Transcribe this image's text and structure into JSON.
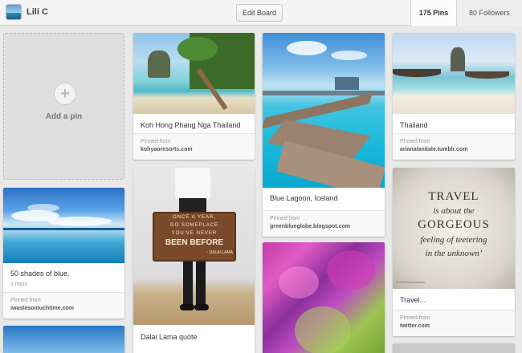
{
  "header": {
    "username": "Lili C",
    "edit_board_label": "Edit Board",
    "pins_count": "175 Pins",
    "followers_count": "80 Followers"
  },
  "add_pin": {
    "label": "Add a pin",
    "icon": "plus-icon"
  },
  "pinned_from_label": "Pinned from",
  "pins": {
    "shades_of_blue": {
      "title": "50 shades of blue.",
      "repins": "1 repin",
      "source": "iwastesomuchtime.com"
    },
    "koh_hong": {
      "title": "Koh Hong Phang Nga Thailand",
      "source": "kohyaoresorts.com"
    },
    "dalai_lama": {
      "title": "Dalai Lama quote",
      "sign_line1": "ONCE A YEAR,",
      "sign_line2": "GO SOMEPLACE",
      "sign_line3": "YOU'VE NEVER",
      "sign_line4": "BEEN BEFORE",
      "sign_author": "- DALAI LAMA"
    },
    "blue_lagoon": {
      "title": "Blue Lagoon, Iceland",
      "source": "greenblueglobe.blogspot.com"
    },
    "thailand": {
      "title": "Thailand",
      "source": "arianalanitale.tumblr.com"
    },
    "travel": {
      "title": "Travel...",
      "source": "twitter.com",
      "quote_line1": "TRAVEL",
      "quote_line2": "is about the",
      "quote_line3": "GORGEOUS",
      "quote_line4": "feeling of teetering",
      "quote_line5": "in the unknown’",
      "copyright": "© 2013 Nina Dobrev"
    }
  },
  "colors": {
    "background": "#e9e9e9",
    "card": "#ffffff",
    "link": "#555555"
  }
}
